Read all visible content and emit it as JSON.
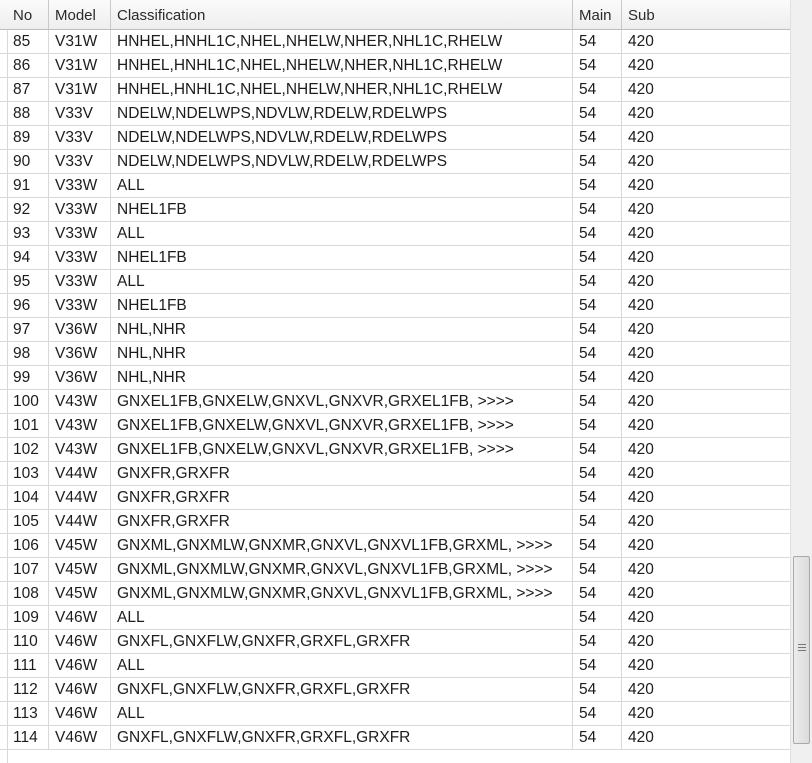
{
  "grid": {
    "columns": [
      "No",
      "Model",
      "Classification",
      "Main",
      "Sub"
    ],
    "rows": [
      {
        "no": "85",
        "model": "V31W",
        "classification": "HNHEL,HNHL1C,NHEL,NHELW,NHER,NHL1C,RHELW",
        "main": "54",
        "sub": "420"
      },
      {
        "no": "86",
        "model": "V31W",
        "classification": "HNHEL,HNHL1C,NHEL,NHELW,NHER,NHL1C,RHELW",
        "main": "54",
        "sub": "420"
      },
      {
        "no": "87",
        "model": "V31W",
        "classification": "HNHEL,HNHL1C,NHEL,NHELW,NHER,NHL1C,RHELW",
        "main": "54",
        "sub": "420"
      },
      {
        "no": "88",
        "model": "V33V",
        "classification": "NDELW,NDELWPS,NDVLW,RDELW,RDELWPS",
        "main": "54",
        "sub": "420"
      },
      {
        "no": "89",
        "model": "V33V",
        "classification": "NDELW,NDELWPS,NDVLW,RDELW,RDELWPS",
        "main": "54",
        "sub": "420"
      },
      {
        "no": "90",
        "model": "V33V",
        "classification": "NDELW,NDELWPS,NDVLW,RDELW,RDELWPS",
        "main": "54",
        "sub": "420"
      },
      {
        "no": "91",
        "model": "V33W",
        "classification": "ALL",
        "main": "54",
        "sub": "420"
      },
      {
        "no": "92",
        "model": "V33W",
        "classification": "NHEL1FB",
        "main": "54",
        "sub": "420"
      },
      {
        "no": "93",
        "model": "V33W",
        "classification": "ALL",
        "main": "54",
        "sub": "420"
      },
      {
        "no": "94",
        "model": "V33W",
        "classification": "NHEL1FB",
        "main": "54",
        "sub": "420"
      },
      {
        "no": "95",
        "model": "V33W",
        "classification": "ALL",
        "main": "54",
        "sub": "420"
      },
      {
        "no": "96",
        "model": "V33W",
        "classification": "NHEL1FB",
        "main": "54",
        "sub": "420"
      },
      {
        "no": "97",
        "model": "V36W",
        "classification": "NHL,NHR",
        "main": "54",
        "sub": "420"
      },
      {
        "no": "98",
        "model": "V36W",
        "classification": "NHL,NHR",
        "main": "54",
        "sub": "420"
      },
      {
        "no": "99",
        "model": "V36W",
        "classification": "NHL,NHR",
        "main": "54",
        "sub": "420"
      },
      {
        "no": "100",
        "model": "V43W",
        "classification": "GNXEL1FB,GNXELW,GNXVL,GNXVR,GRXEL1FB,  >>>>",
        "main": "54",
        "sub": "420"
      },
      {
        "no": "101",
        "model": "V43W",
        "classification": "GNXEL1FB,GNXELW,GNXVL,GNXVR,GRXEL1FB,  >>>>",
        "main": "54",
        "sub": "420"
      },
      {
        "no": "102",
        "model": "V43W",
        "classification": "GNXEL1FB,GNXELW,GNXVL,GNXVR,GRXEL1FB,  >>>>",
        "main": "54",
        "sub": "420"
      },
      {
        "no": "103",
        "model": "V44W",
        "classification": "GNXFR,GRXFR",
        "main": "54",
        "sub": "420"
      },
      {
        "no": "104",
        "model": "V44W",
        "classification": "GNXFR,GRXFR",
        "main": "54",
        "sub": "420"
      },
      {
        "no": "105",
        "model": "V44W",
        "classification": "GNXFR,GRXFR",
        "main": "54",
        "sub": "420"
      },
      {
        "no": "106",
        "model": "V45W",
        "classification": "GNXML,GNXMLW,GNXMR,GNXVL,GNXVL1FB,GRXML,  >>>>",
        "main": "54",
        "sub": "420"
      },
      {
        "no": "107",
        "model": "V45W",
        "classification": "GNXML,GNXMLW,GNXMR,GNXVL,GNXVL1FB,GRXML,  >>>>",
        "main": "54",
        "sub": "420"
      },
      {
        "no": "108",
        "model": "V45W",
        "classification": "GNXML,GNXMLW,GNXMR,GNXVL,GNXVL1FB,GRXML,  >>>>",
        "main": "54",
        "sub": "420"
      },
      {
        "no": "109",
        "model": "V46W",
        "classification": "ALL",
        "main": "54",
        "sub": "420"
      },
      {
        "no": "110",
        "model": "V46W",
        "classification": "GNXFL,GNXFLW,GNXFR,GRXFL,GRXFR",
        "main": "54",
        "sub": "420"
      },
      {
        "no": "111",
        "model": "V46W",
        "classification": "ALL",
        "main": "54",
        "sub": "420"
      },
      {
        "no": "112",
        "model": "V46W",
        "classification": "GNXFL,GNXFLW,GNXFR,GRXFL,GRXFR",
        "main": "54",
        "sub": "420"
      },
      {
        "no": "113",
        "model": "V46W",
        "classification": "ALL",
        "main": "54",
        "sub": "420"
      },
      {
        "no": "114",
        "model": "V46W",
        "classification": "GNXFL,GNXFLW,GNXFR,GRXFL,GRXFR",
        "main": "54",
        "sub": "420"
      }
    ]
  },
  "scrollbar": {
    "thumb_icon": "grip-icon",
    "position_fraction": 0.93
  }
}
